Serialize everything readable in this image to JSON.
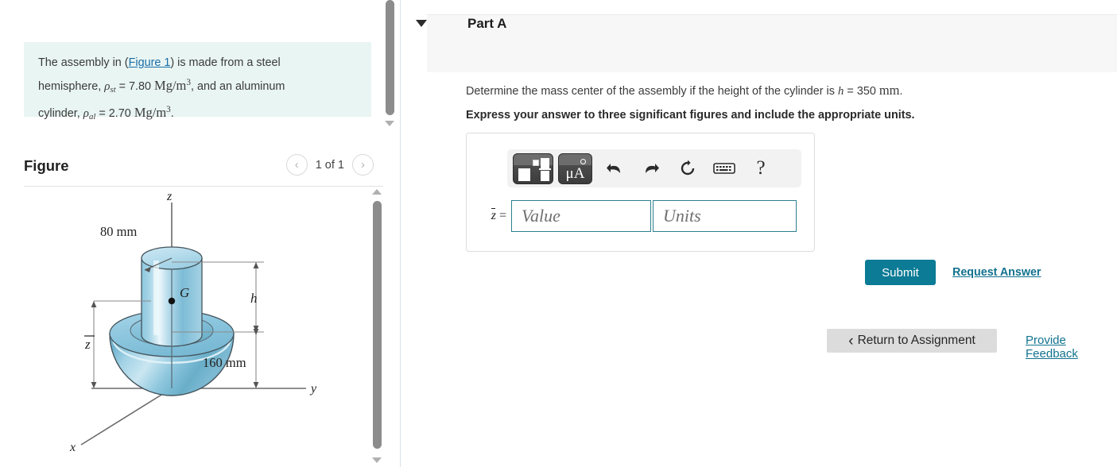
{
  "problem": {
    "line1_pre": "The assembly in (",
    "line1_link": "Figure 1",
    "line1_post": ") is made from a steel",
    "line2_pre": "hemisphere, ",
    "line2_sym": "ρ",
    "line2_sub": "st",
    "line2_eq": " = 7.80 ",
    "line2_units": "Mg/m",
    "line2_exp": "3",
    "line2_post": ", and an aluminum",
    "line3_pre": "cylinder, ",
    "line3_sym": "ρ",
    "line3_sub": "al",
    "line3_eq": " = 2.70 ",
    "line3_units": "Mg/m",
    "line3_exp": "3",
    "line3_post": "."
  },
  "figure": {
    "title": "Figure",
    "counter": "1 of 1",
    "prev_icon": "‹",
    "next_icon": "›",
    "labels": {
      "z_axis": "z",
      "y_axis": "y",
      "x_axis": "x",
      "dim_diameter": "80 mm",
      "dim_sphere": "160 mm",
      "dim_height": "h",
      "centroid": "G",
      "zbar": "z"
    },
    "colors": {
      "body_light": "#cfe6f2",
      "body_mid": "#8fc9e0",
      "body_dark": "#5aa7c6",
      "outline": "#44545c",
      "axis": "#6b6b6b"
    }
  },
  "part": {
    "title": "Part A",
    "caret_icon": "caret-down-icon",
    "question_pre": "Determine the mass center of the assembly if the height of the cylinder is ",
    "question_sym": "h",
    "question_eq": " = 350 ",
    "question_units": "mm",
    "question_post": ".",
    "instruction": "Express your answer to three significant figures and include the appropriate units."
  },
  "toolbar": {
    "template_icon": "math-template-icon",
    "units_icon": "micro-angstrom-icon",
    "units_label": "μA",
    "undo_icon": "undo-arrow-icon",
    "redo_icon": "redo-arrow-icon",
    "reset_icon": "reset-circular-arrow-icon",
    "keyboard_icon": "keyboard-icon",
    "help_icon": "?"
  },
  "answer": {
    "label": "z",
    "label_eq": " =",
    "value_placeholder": "Value",
    "units_placeholder": "Units",
    "value": "",
    "units": ""
  },
  "actions": {
    "submit": "Submit",
    "request_answer": "Request Answer",
    "return_icon": "‹",
    "return_label": "Return to Assignment",
    "provide_feedback": "Provide Feedback"
  },
  "theme": {
    "accent_teal": "#0b7b96",
    "link_teal": "#12728e",
    "info_bg": "#e9f5f3",
    "panel_gray": "#f7f7f7",
    "button_gray": "#dcdcdc"
  }
}
